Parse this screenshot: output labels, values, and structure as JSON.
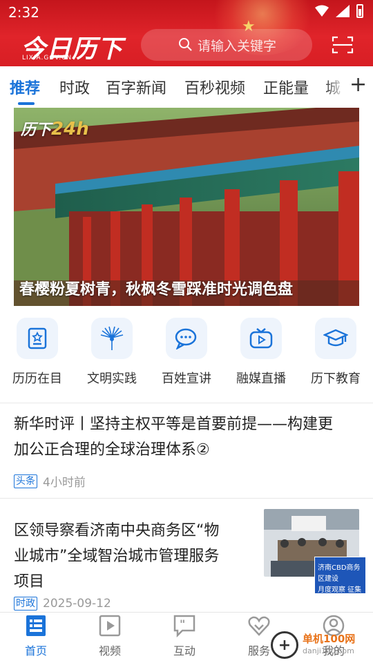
{
  "status": {
    "time": "2:32"
  },
  "header": {
    "logo": "今日历下",
    "logo_sub": "LIXIA.GOV.CN",
    "search_placeholder": "请输入关键字",
    "accent": "#d81e24"
  },
  "tabs": [
    {
      "label": "推荐",
      "active": true
    },
    {
      "label": "时政"
    },
    {
      "label": "百字新闻"
    },
    {
      "label": "百秒视频"
    },
    {
      "label": "正能量"
    },
    {
      "label": "城"
    }
  ],
  "banner": {
    "badge_text": "历下",
    "badge_num": "24h",
    "caption": "春樱粉夏树青，秋枫冬雪踩准时光调色盘"
  },
  "quick_entries": [
    {
      "label": "历历在目",
      "icon": "id-card-icon"
    },
    {
      "label": "文明实践",
      "icon": "peacock-icon"
    },
    {
      "label": "百姓宣讲",
      "icon": "chat-bubbles-icon"
    },
    {
      "label": "融媒直播",
      "icon": "tv-play-icon"
    },
    {
      "label": "历下教育",
      "icon": "graduation-cap-icon"
    }
  ],
  "news": [
    {
      "title_line1": "新华时评丨坚持主权平等是首要前提——构建更",
      "title_line2": "加公正合理的全球治理体系②",
      "tag": "头条",
      "time": "4小时前"
    },
    {
      "title_line1": "区领导察看济南中央商务区“物",
      "title_line2": "业城市”全域智治城市管理服务",
      "title_line3": "项目",
      "tag": "时政",
      "time": "2025-09-12",
      "thumb_overlay_line1": "济南CBD商务区建设",
      "thumb_overlay_line2": "月度观察 征集"
    }
  ],
  "bottom_nav": [
    {
      "label": "首页",
      "icon": "home-list-icon",
      "active": true
    },
    {
      "label": "视频",
      "icon": "video-play-icon"
    },
    {
      "label": "互动",
      "icon": "quote-bubble-icon"
    },
    {
      "label": "服务",
      "icon": "heart-service-icon"
    },
    {
      "label": "我的",
      "icon": "user-circle-icon"
    }
  ],
  "watermark": {
    "title": "单机100网",
    "url": "danji100.com"
  }
}
